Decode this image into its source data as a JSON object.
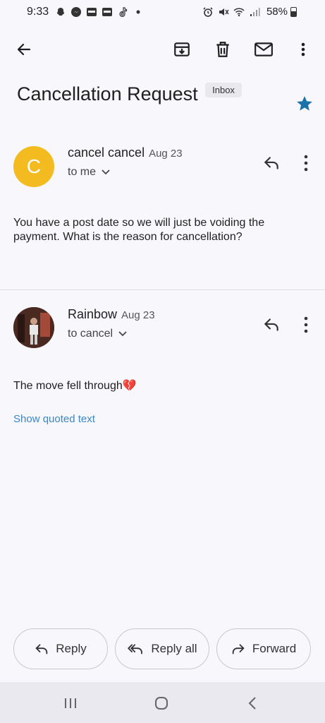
{
  "status_bar": {
    "time": "9:33",
    "battery_percent": "58%",
    "left_icons": [
      "snapchat-icon",
      "messenger-icon",
      "free-app-icon",
      "free-app-icon",
      "tiktok-icon",
      "dot-icon"
    ],
    "right_icons": [
      "alarm-icon",
      "mute-icon",
      "wifi-icon",
      "signal-icon"
    ]
  },
  "toolbar": {
    "back": "back-arrow-icon",
    "archive": "archive-icon",
    "delete": "trash-icon",
    "mark_unread": "mail-icon",
    "more": "more-vert-icon"
  },
  "email": {
    "subject": "Cancellation Request",
    "label": "Inbox",
    "starred": true,
    "star_color": "#1a73a8"
  },
  "messages": [
    {
      "avatar_letter": "C",
      "avatar_color": "#f3bb20",
      "sender": "cancel cancel",
      "date": "Aug 23",
      "recipient": "to me",
      "body": "You have a post date so we will just be voiding the payment. What is the reason for cancellation?"
    },
    {
      "sender": "Rainbow",
      "date": "Aug 23",
      "recipient": "to cancel",
      "body": "The move fell through💔",
      "show_quoted": "Show quoted text"
    }
  ],
  "actions": {
    "reply": "Reply",
    "reply_all": "Reply all",
    "forward": "Forward"
  },
  "nav": {
    "recents": "recents-icon",
    "home": "home-icon",
    "back": "nav-back-icon"
  }
}
